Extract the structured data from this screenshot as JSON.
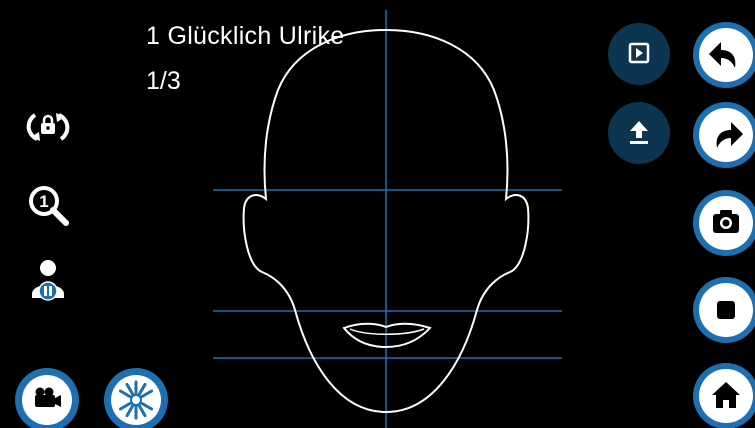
{
  "exercise": {
    "title": "1 Glücklich Ulrike",
    "progress": "1/3"
  },
  "left_controls": {
    "icons": [
      "rotation-lock-icon",
      "zoom-one-icon",
      "user-pause-icon"
    ]
  },
  "bottom_left_buttons": [
    "video-camera-icon",
    "snowflake-icon"
  ],
  "right_top_buttons": [
    "play-video-icon",
    "upload-icon"
  ],
  "right_buttons": [
    "undo-arrow-icon",
    "redo-arrow-icon",
    "camera-icon",
    "stop-icon",
    "home-icon"
  ],
  "colors": {
    "background": "#000000",
    "guide_line": "#1e6fb0",
    "face_outline": "#ffffff",
    "button_blue": "#1e6fb0",
    "button_dark": "#0d3550",
    "button_white": "#ffffff"
  }
}
